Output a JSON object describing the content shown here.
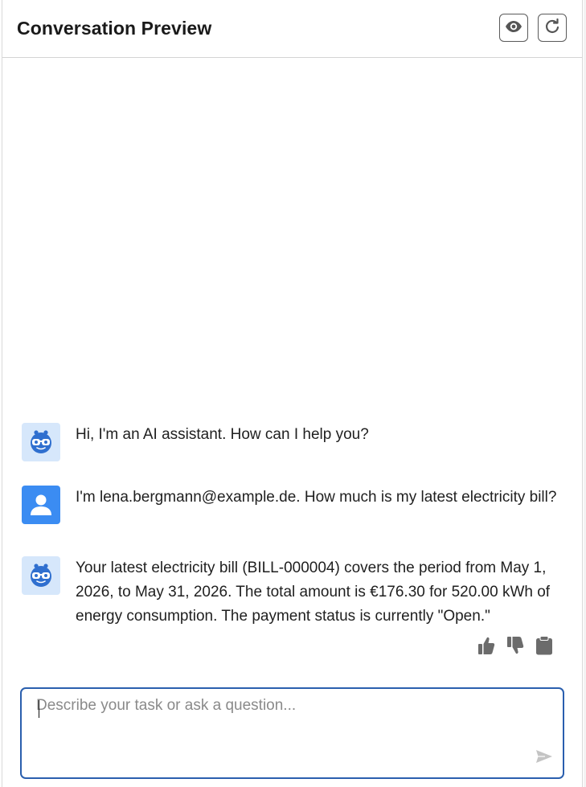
{
  "header": {
    "title": "Conversation Preview",
    "preview_icon": "eye-icon",
    "refresh_icon": "refresh-icon"
  },
  "messages": [
    {
      "role": "assistant",
      "avatar_icon": "bot-avatar-icon",
      "text": "Hi, I'm an AI assistant. How can I help you?"
    },
    {
      "role": "user",
      "avatar_icon": "user-avatar-icon",
      "text": "I'm lena.bergmann@example.de. How much is my latest electricity bill?"
    },
    {
      "role": "assistant",
      "avatar_icon": "bot-avatar-icon",
      "text": "Your latest electricity bill (BILL-000004) covers the period from May 1, 2026, to May 31, 2026. The total amount is €176.30 for 520.00 kWh of energy consumption. The payment status is currently \"Open.\""
    }
  ],
  "feedback": {
    "thumbs_up_icon": "thumbs-up-icon",
    "thumbs_down_icon": "thumbs-down-icon",
    "copy_icon": "clipboard-icon"
  },
  "composer": {
    "value": "",
    "placeholder": "Describe your task or ask a question...",
    "send_icon": "send-icon"
  },
  "colors": {
    "accent_border": "#2a5fae",
    "bot_avatar_bg": "#d6e7fb",
    "bot_avatar_fg": "#2f6fcf",
    "user_avatar_bg": "#3b8cf2",
    "icon_gray": "#6b6b6b"
  }
}
